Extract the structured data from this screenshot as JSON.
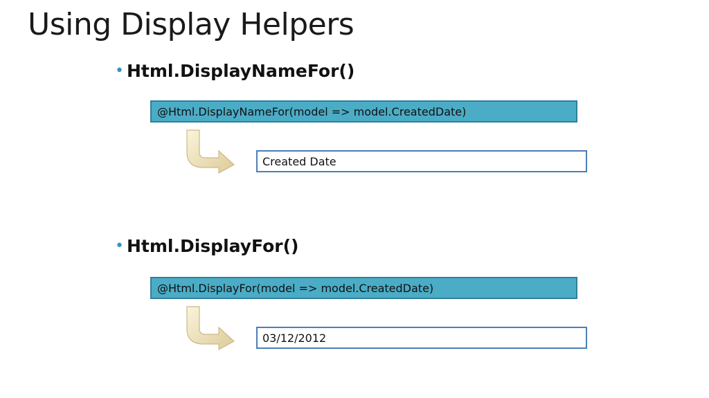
{
  "slide": {
    "title": "Using Display Helpers",
    "sections": [
      {
        "bullet_icon": "bullet-dot",
        "heading": "Html.DisplayNameFor()",
        "code": "@Html.DisplayNameFor(model => model.CreatedDate)",
        "arrow_icon": "curved-arrow-icon",
        "output": "Created Date"
      },
      {
        "bullet_icon": "bullet-dot",
        "heading": "Html.DisplayFor()",
        "code": "@Html.DisplayFor(model => model.CreatedDate)",
        "arrow_icon": "curved-arrow-icon",
        "output": "03/12/2012"
      }
    ]
  },
  "colors": {
    "bullet": "#3b8fc4",
    "code_box_fill": "#4bacc6",
    "code_box_border": "#2f7f9c",
    "output_box_border": "#4a7fb5",
    "arrow_fill": "#f2e6c2"
  }
}
